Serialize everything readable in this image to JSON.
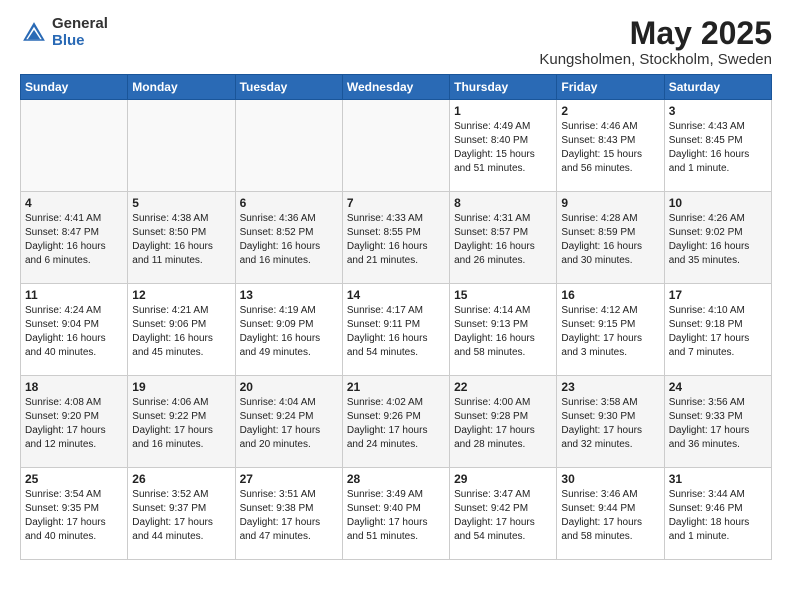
{
  "header": {
    "logo_general": "General",
    "logo_blue": "Blue",
    "month_title": "May 2025",
    "location": "Kungsholmen, Stockholm, Sweden"
  },
  "days_of_week": [
    "Sunday",
    "Monday",
    "Tuesday",
    "Wednesday",
    "Thursday",
    "Friday",
    "Saturday"
  ],
  "weeks": [
    [
      {
        "day": "",
        "info": ""
      },
      {
        "day": "",
        "info": ""
      },
      {
        "day": "",
        "info": ""
      },
      {
        "day": "",
        "info": ""
      },
      {
        "day": "1",
        "info": "Sunrise: 4:49 AM\nSunset: 8:40 PM\nDaylight: 15 hours\nand 51 minutes."
      },
      {
        "day": "2",
        "info": "Sunrise: 4:46 AM\nSunset: 8:43 PM\nDaylight: 15 hours\nand 56 minutes."
      },
      {
        "day": "3",
        "info": "Sunrise: 4:43 AM\nSunset: 8:45 PM\nDaylight: 16 hours\nand 1 minute."
      }
    ],
    [
      {
        "day": "4",
        "info": "Sunrise: 4:41 AM\nSunset: 8:47 PM\nDaylight: 16 hours\nand 6 minutes."
      },
      {
        "day": "5",
        "info": "Sunrise: 4:38 AM\nSunset: 8:50 PM\nDaylight: 16 hours\nand 11 minutes."
      },
      {
        "day": "6",
        "info": "Sunrise: 4:36 AM\nSunset: 8:52 PM\nDaylight: 16 hours\nand 16 minutes."
      },
      {
        "day": "7",
        "info": "Sunrise: 4:33 AM\nSunset: 8:55 PM\nDaylight: 16 hours\nand 21 minutes."
      },
      {
        "day": "8",
        "info": "Sunrise: 4:31 AM\nSunset: 8:57 PM\nDaylight: 16 hours\nand 26 minutes."
      },
      {
        "day": "9",
        "info": "Sunrise: 4:28 AM\nSunset: 8:59 PM\nDaylight: 16 hours\nand 30 minutes."
      },
      {
        "day": "10",
        "info": "Sunrise: 4:26 AM\nSunset: 9:02 PM\nDaylight: 16 hours\nand 35 minutes."
      }
    ],
    [
      {
        "day": "11",
        "info": "Sunrise: 4:24 AM\nSunset: 9:04 PM\nDaylight: 16 hours\nand 40 minutes."
      },
      {
        "day": "12",
        "info": "Sunrise: 4:21 AM\nSunset: 9:06 PM\nDaylight: 16 hours\nand 45 minutes."
      },
      {
        "day": "13",
        "info": "Sunrise: 4:19 AM\nSunset: 9:09 PM\nDaylight: 16 hours\nand 49 minutes."
      },
      {
        "day": "14",
        "info": "Sunrise: 4:17 AM\nSunset: 9:11 PM\nDaylight: 16 hours\nand 54 minutes."
      },
      {
        "day": "15",
        "info": "Sunrise: 4:14 AM\nSunset: 9:13 PM\nDaylight: 16 hours\nand 58 minutes."
      },
      {
        "day": "16",
        "info": "Sunrise: 4:12 AM\nSunset: 9:15 PM\nDaylight: 17 hours\nand 3 minutes."
      },
      {
        "day": "17",
        "info": "Sunrise: 4:10 AM\nSunset: 9:18 PM\nDaylight: 17 hours\nand 7 minutes."
      }
    ],
    [
      {
        "day": "18",
        "info": "Sunrise: 4:08 AM\nSunset: 9:20 PM\nDaylight: 17 hours\nand 12 minutes."
      },
      {
        "day": "19",
        "info": "Sunrise: 4:06 AM\nSunset: 9:22 PM\nDaylight: 17 hours\nand 16 minutes."
      },
      {
        "day": "20",
        "info": "Sunrise: 4:04 AM\nSunset: 9:24 PM\nDaylight: 17 hours\nand 20 minutes."
      },
      {
        "day": "21",
        "info": "Sunrise: 4:02 AM\nSunset: 9:26 PM\nDaylight: 17 hours\nand 24 minutes."
      },
      {
        "day": "22",
        "info": "Sunrise: 4:00 AM\nSunset: 9:28 PM\nDaylight: 17 hours\nand 28 minutes."
      },
      {
        "day": "23",
        "info": "Sunrise: 3:58 AM\nSunset: 9:30 PM\nDaylight: 17 hours\nand 32 minutes."
      },
      {
        "day": "24",
        "info": "Sunrise: 3:56 AM\nSunset: 9:33 PM\nDaylight: 17 hours\nand 36 minutes."
      }
    ],
    [
      {
        "day": "25",
        "info": "Sunrise: 3:54 AM\nSunset: 9:35 PM\nDaylight: 17 hours\nand 40 minutes."
      },
      {
        "day": "26",
        "info": "Sunrise: 3:52 AM\nSunset: 9:37 PM\nDaylight: 17 hours\nand 44 minutes."
      },
      {
        "day": "27",
        "info": "Sunrise: 3:51 AM\nSunset: 9:38 PM\nDaylight: 17 hours\nand 47 minutes."
      },
      {
        "day": "28",
        "info": "Sunrise: 3:49 AM\nSunset: 9:40 PM\nDaylight: 17 hours\nand 51 minutes."
      },
      {
        "day": "29",
        "info": "Sunrise: 3:47 AM\nSunset: 9:42 PM\nDaylight: 17 hours\nand 54 minutes."
      },
      {
        "day": "30",
        "info": "Sunrise: 3:46 AM\nSunset: 9:44 PM\nDaylight: 17 hours\nand 58 minutes."
      },
      {
        "day": "31",
        "info": "Sunrise: 3:44 AM\nSunset: 9:46 PM\nDaylight: 18 hours\nand 1 minute."
      }
    ]
  ]
}
